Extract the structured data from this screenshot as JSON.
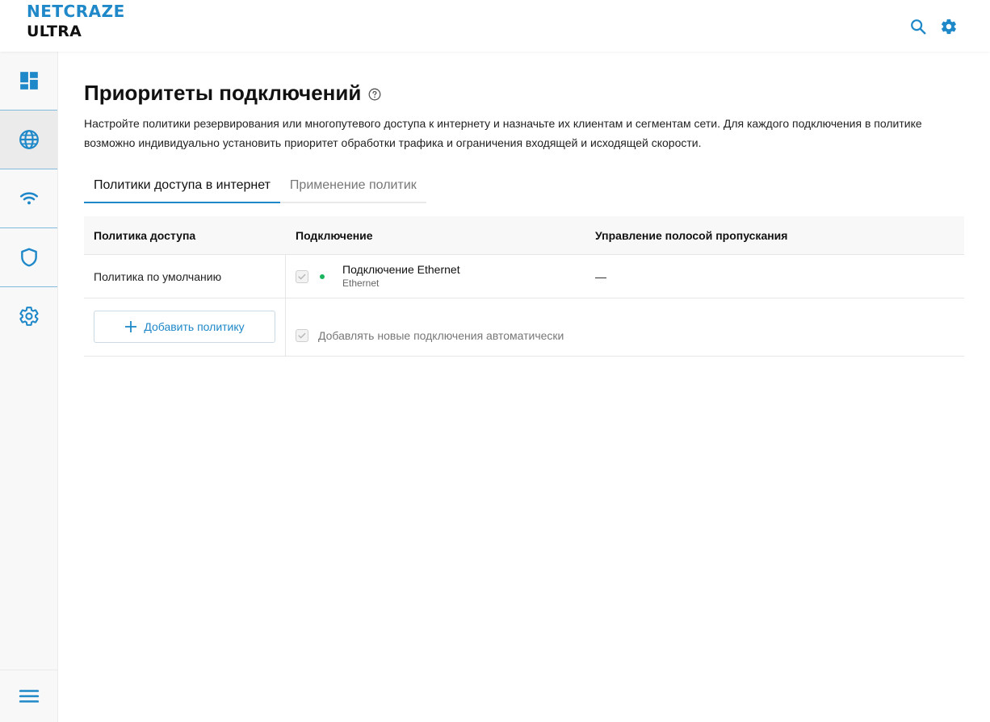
{
  "brand": {
    "name": "NETCRAZE",
    "model": "ULTRA"
  },
  "colors": {
    "accent": "#1e88c8",
    "status_ok": "#1ab35e"
  },
  "header": {
    "icons": [
      "search-icon",
      "gear-icon"
    ]
  },
  "sidebar": {
    "items": [
      {
        "icon": "dashboard-icon"
      },
      {
        "icon": "globe-icon",
        "active": true
      },
      {
        "icon": "wifi-icon"
      },
      {
        "icon": "shield-icon"
      },
      {
        "icon": "gear-icon"
      }
    ],
    "menu_icon": "hamburger-icon"
  },
  "page": {
    "title": "Приоритеты подключений",
    "description": "Настройте политики резервирования или многопутевого доступа к интернету и назначьте их клиентам и сегментам сети. Для каждого подключения в политике возможно индивидуально установить приоритет обработки трафика и ограничения входящей и исходящей скорости."
  },
  "tabs": [
    {
      "label": "Политики доступа в интернет",
      "active": true
    },
    {
      "label": "Применение политик",
      "active": false
    }
  ],
  "table": {
    "headers": {
      "policy": "Политика доступа",
      "connection": "Подключение",
      "bandwidth": "Управление полосой пропускания"
    },
    "rows": [
      {
        "policy": "Политика по умолчанию",
        "connection_name": "Подключение Ethernet",
        "connection_type": "Ethernet",
        "bandwidth": "—",
        "checked": true
      }
    ],
    "add_policy_label": "Добавить политику",
    "auto_add_label": "Добавлять новые подключения автоматически",
    "auto_add_checked": true
  }
}
